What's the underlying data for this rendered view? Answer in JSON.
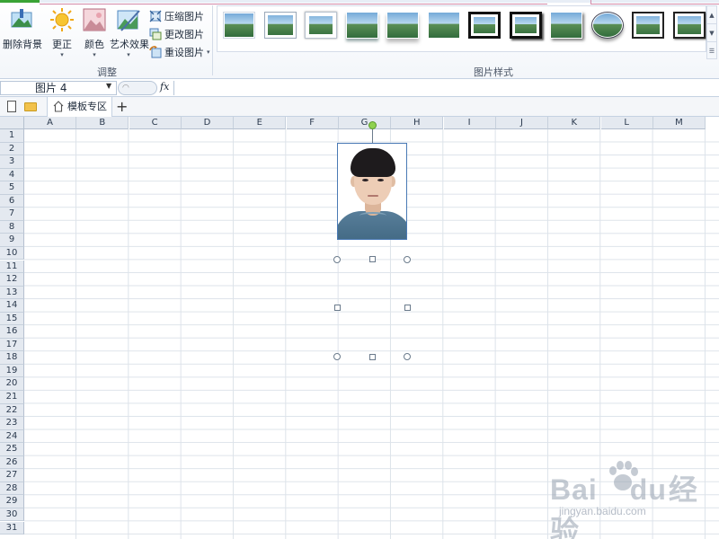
{
  "ribbon": {
    "buttons_big": [
      {
        "label": "删除背景",
        "icon": "remove-background-icon"
      },
      {
        "label": "更正",
        "icon": "sun-icon",
        "has_dropdown": true
      },
      {
        "label": "颜色",
        "icon": "color-icon",
        "has_dropdown": true
      },
      {
        "label": "艺术效果",
        "icon": "art-effect-icon",
        "has_dropdown": true
      }
    ],
    "buttons_small": [
      {
        "label": "压缩图片",
        "icon": "compress-icon"
      },
      {
        "label": "更改图片",
        "icon": "change-picture-icon"
      },
      {
        "label": "重设图片",
        "icon": "reset-picture-icon",
        "has_dropdown": true
      }
    ],
    "group_adjust_label": "调整",
    "group_style_label": "图片样式",
    "picture_style_count": 12,
    "dropdown_arrow": "▾"
  },
  "formula_bar": {
    "name_box": "图片 4",
    "fx_label": "fx",
    "formula_value": ""
  },
  "tabbar": {
    "tab_label": "模板专区",
    "add_tab": "+"
  },
  "sheet": {
    "columns": [
      "A",
      "B",
      "C",
      "D",
      "E",
      "F",
      "G",
      "H",
      "I",
      "J",
      "K",
      "L",
      "M"
    ],
    "rows": [
      "1",
      "2",
      "3",
      "4",
      "5",
      "6",
      "7",
      "8",
      "9",
      "10",
      "11",
      "12",
      "13",
      "14",
      "15",
      "16",
      "17",
      "18",
      "19",
      "20",
      "21",
      "22",
      "23",
      "24",
      "25",
      "26",
      "27",
      "28",
      "29",
      "30",
      "31"
    ],
    "selected_object": "图片 4"
  },
  "watermark": {
    "text": "Bai",
    "text2": "du",
    "text3": "经验",
    "url": "jingyan.baidu.com"
  },
  "colors": {
    "accent": "#4a7ab5",
    "rotate_handle": "#8fd14f"
  }
}
